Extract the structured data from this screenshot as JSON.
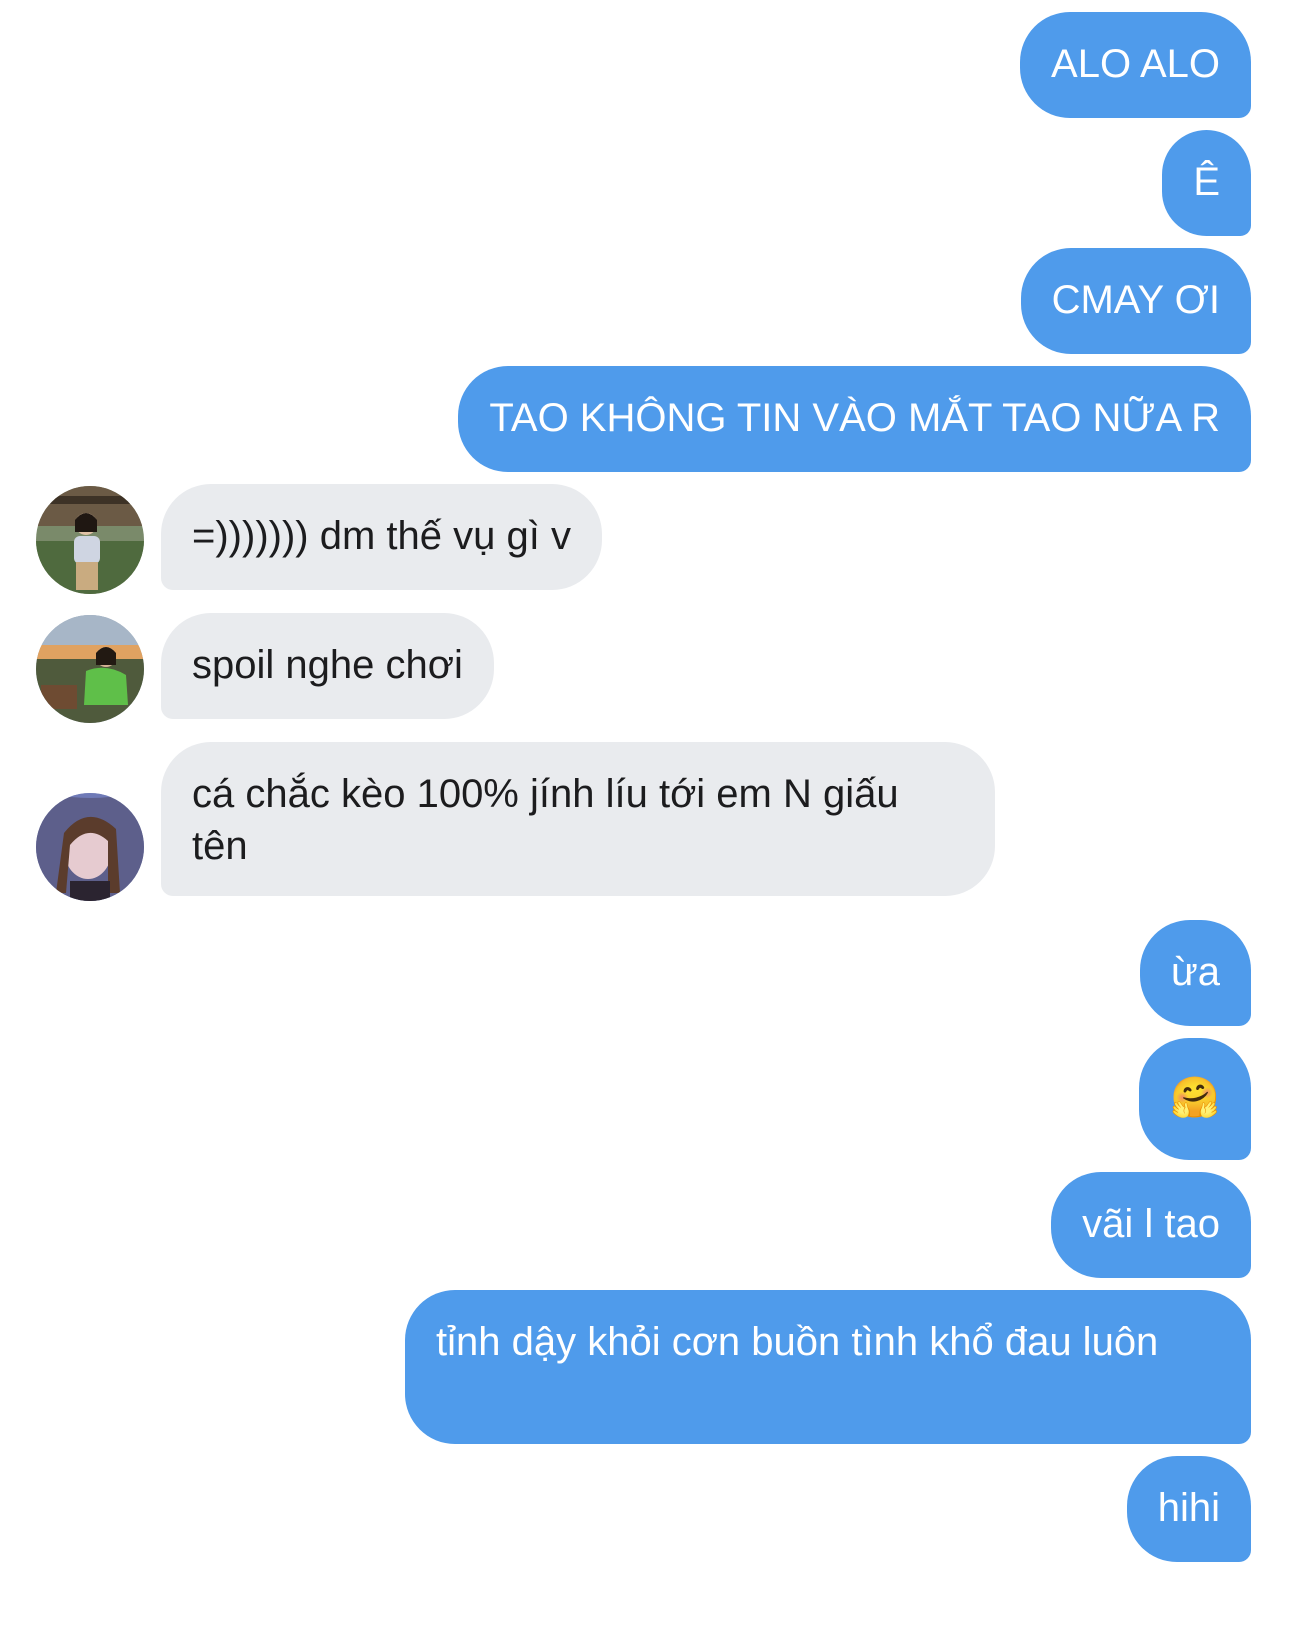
{
  "conversation": {
    "messages": [
      {
        "sender": "me",
        "text": "ALO ALO"
      },
      {
        "sender": "me",
        "text": "Ê"
      },
      {
        "sender": "me",
        "text": "CMAY ƠI"
      },
      {
        "sender": "me",
        "text": "TAO KHÔNG TIN VÀO MẮT TAO NỮA R"
      },
      {
        "sender": "friend-1",
        "text": "=))))))) dm thế vụ gì v"
      },
      {
        "sender": "friend-2",
        "text": "spoil nghe chơi"
      },
      {
        "sender": "friend-3",
        "text": "cá chắc kèo 100% jính líu tới em N giấu tên"
      },
      {
        "sender": "me",
        "text": "ừa"
      },
      {
        "sender": "me",
        "text": "🤗",
        "icon": "hugging-face-emoji"
      },
      {
        "sender": "me",
        "text": "vãi l tao"
      },
      {
        "sender": "me",
        "text": "tỉnh dậy khỏi cơn buồn tình khổ đau luôn"
      },
      {
        "sender": "me",
        "text": "hihi"
      }
    ]
  },
  "colors": {
    "outgoing_bubble": "#4f9beb",
    "outgoing_text": "#ffffff",
    "incoming_bubble": "#e9ebee",
    "incoming_text": "#1c1c1e",
    "background": "#ffffff"
  }
}
